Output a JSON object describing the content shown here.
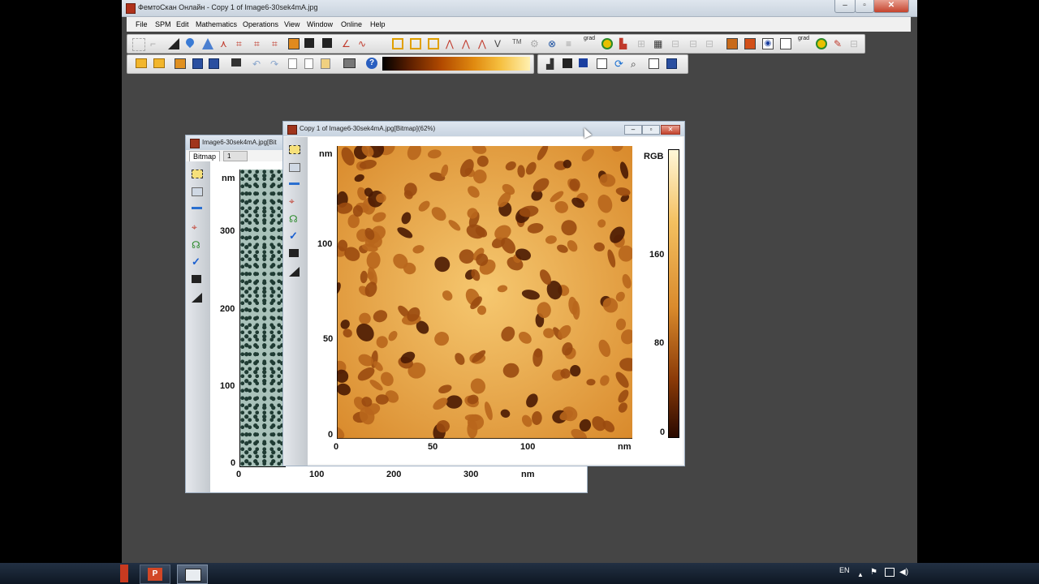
{
  "app": {
    "title": "ФемтоСкан Онлайн - Copy 1 of Image6-30sek4mA.jpg",
    "menu": [
      "File",
      "SPM",
      "Edit",
      "Mathematics",
      "Operations",
      "View",
      "Window",
      "Online",
      "Help"
    ],
    "toolbar_row1_text": {
      "grad1": "grad",
      "grad2": "grad",
      "grad3": "grad"
    }
  },
  "back_window": {
    "title": "Image6-30sek4mA.jpg[Bit",
    "tabs": [
      "Bitmap",
      "1"
    ],
    "y_unit": "nm",
    "y_ticks": [
      "300",
      "200",
      "100",
      "0"
    ],
    "x_ticks": [
      "0",
      "100",
      "200",
      "300"
    ],
    "x_unit": "nm"
  },
  "front_window": {
    "title": "Copy 1 of Image6-30sek4mA.jpg[Bitmap](62%)",
    "y_unit": "nm",
    "y_ticks": [
      "100",
      "50",
      "0"
    ],
    "x_ticks": [
      "0",
      "50",
      "100"
    ],
    "x_unit": "nm",
    "colorbar_label": "RGB",
    "colorbar_ticks": [
      "160",
      "80",
      "0"
    ]
  },
  "taskbar": {
    "lang": "EN"
  },
  "colors": {
    "app_bg": "#454545",
    "afm_light": "#f2c46a",
    "afm_dark": "#5a2204",
    "back_image": "#9fb8b0"
  }
}
